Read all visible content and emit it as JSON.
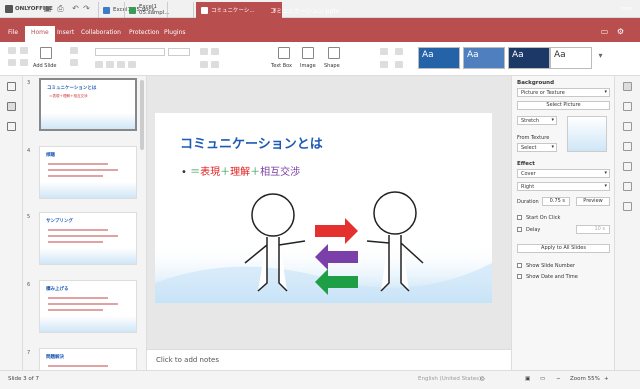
{
  "app": {
    "name": "ONLYOFFICE",
    "doc_title": "コミュニケーション.pptx",
    "user": "nory"
  },
  "tabs": [
    {
      "label": "Excel1 05.docx"
    },
    {
      "label": "Excel1 05.sampl..."
    },
    {
      "label": "コミュニケーシ..."
    }
  ],
  "menu": [
    "File",
    "Home",
    "Insert",
    "Collaboration",
    "Protection",
    "Plugins"
  ],
  "toolbar": {
    "add_slide": "Add Slide",
    "text_box": "Text Box",
    "image": "Image",
    "shape": "Shape",
    "theme_label": "Aa"
  },
  "slides": [
    {
      "num": "3",
      "title": "コミュニケーションとは",
      "sub": "＝表現＋理解＋相互交渉"
    },
    {
      "num": "4",
      "title": "傾聴"
    },
    {
      "num": "5",
      "title": "サンプリング"
    },
    {
      "num": "6",
      "title": "積み上げる"
    },
    {
      "num": "7",
      "title": "問題解決"
    }
  ],
  "current_slide": {
    "title": "コミュニケーションとは",
    "bullet": {
      "p1": "＝",
      "p2": "表現",
      "p3": "＋",
      "p4": "理解",
      "p5": "＋",
      "p6": "相互交渉"
    }
  },
  "notes_placeholder": "Click to add notes",
  "panel": {
    "background": "Background",
    "fill": "Picture or Texture",
    "select_picture": "Select Picture",
    "stretch": "Stretch",
    "from_texture": "From Texture",
    "select": "Select",
    "effect": "Effect",
    "effect_val": "Cover",
    "dir_val": "Right",
    "duration_label": "Duration",
    "duration_val": "0.75 s",
    "preview": "Preview",
    "start_on_click": "Start On Click",
    "delay_label": "Delay",
    "delay_val": "10 s",
    "apply_all": "Apply to All Slides",
    "show_slide_number": "Show Slide Number",
    "show_date_time": "Show Date and Time"
  },
  "status": {
    "slide": "Slide 3 of 7",
    "language": "English (United States)",
    "zoom": "Zoom 55%"
  }
}
